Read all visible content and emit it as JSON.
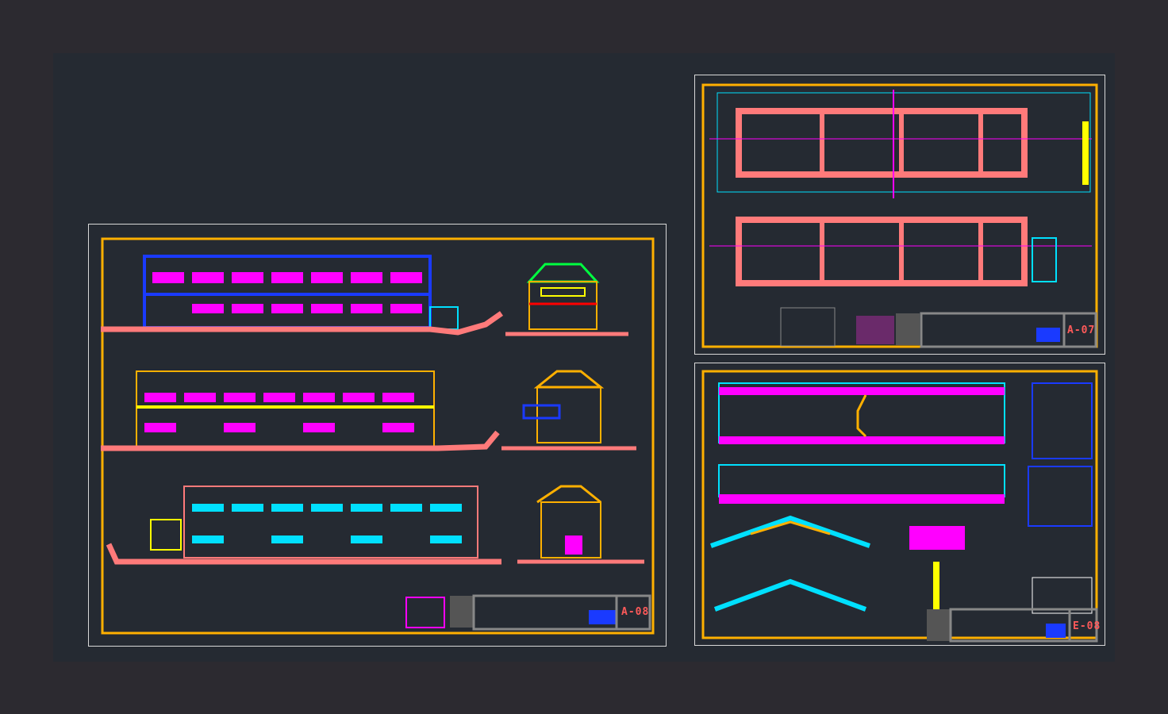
{
  "sheets": [
    {
      "id": "elevations",
      "number": "A-08"
    },
    {
      "id": "floor-plans",
      "number": "A-07"
    },
    {
      "id": "structure",
      "number": "E-08"
    }
  ],
  "colors": {
    "background": "#2c2a30",
    "model_space": "#252a32",
    "frame": "#ffb000",
    "magenta": "#ff00ff",
    "cyan": "#00e0ff",
    "salmon": "#ff7a7a",
    "blue": "#1a3aff",
    "yellow": "#ffff00",
    "green": "#00ff40"
  }
}
